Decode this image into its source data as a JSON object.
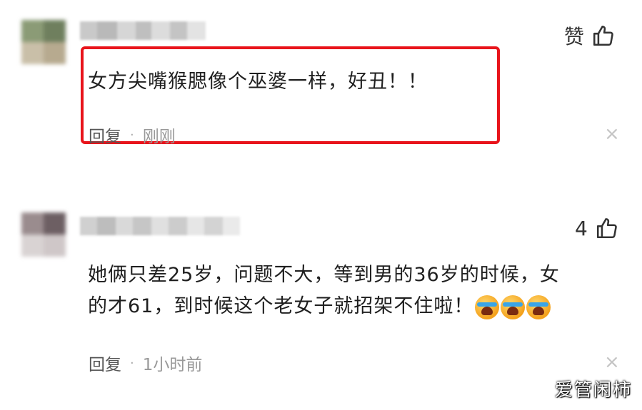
{
  "comments": [
    {
      "text": "女方尖嘴猴腮像个巫婆一样，好丑！！",
      "reply_label": "回复",
      "separator": "·",
      "time": "刚刚",
      "like_label": "赞",
      "close_glyph": "×"
    },
    {
      "text_line1": "她俩只差25岁，问题不大，等到男的36岁的时候，女",
      "text_line2": "的才61，到时候这个老女子就招架不住啦！",
      "reply_label": "回复",
      "separator": "·",
      "time": "1小时前",
      "like_count": "4",
      "close_glyph": "×",
      "emojis": [
        "crying-emoji",
        "crying-emoji",
        "crying-emoji"
      ]
    }
  ],
  "highlight_color": "#e8141b",
  "watermark": "爱管闲柿",
  "icons": {
    "like": "thumbs-up-icon",
    "close": "close-icon"
  }
}
